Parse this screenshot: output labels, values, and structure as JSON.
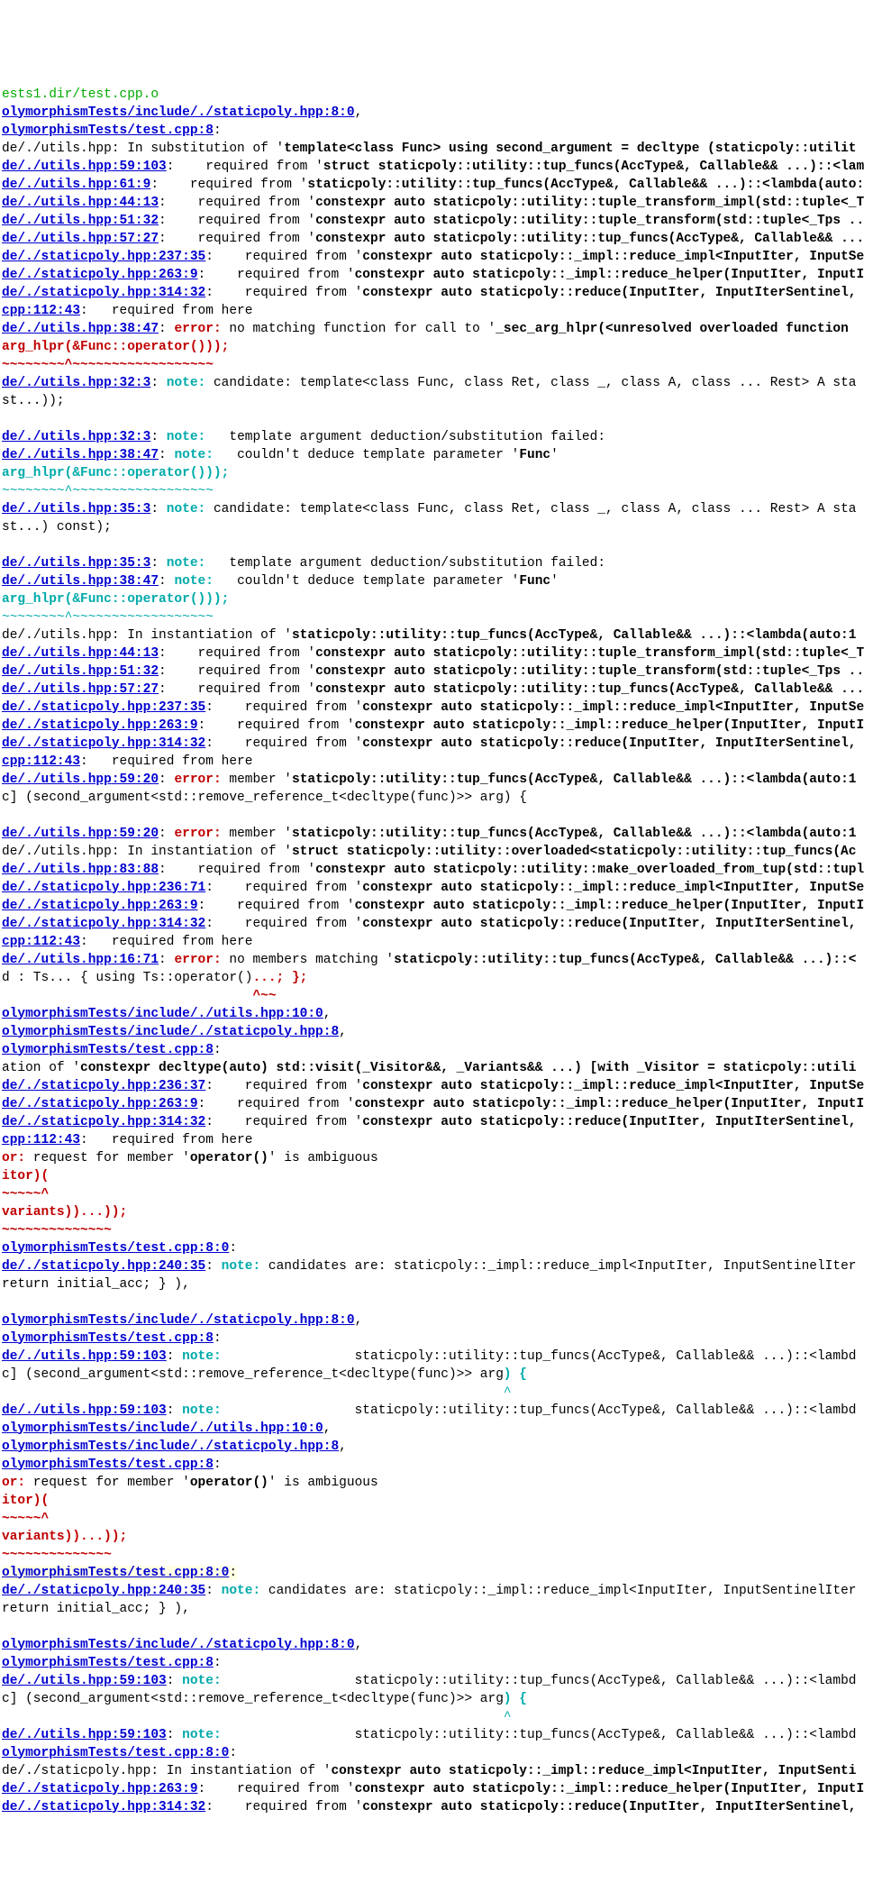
{
  "p": {
    "utils": "de/./utils.hpp",
    "sp": "de/./staticpoly.hpp",
    "inc_sp": "olymorphismTests/include/./staticpoly.hpp:8:0",
    "inc_sp8": "olymorphismTests/include/./staticpoly.hpp:8",
    "inc_ut": "olymorphismTests/include/./utils.hpp:10:0",
    "test80": "olymorphismTests/test.cpp:8:0",
    "test8": "olymorphismTests/test.cpp:8",
    "cpp112": "cpp:112:43"
  },
  "loc": {
    "u59_103": ":59:103",
    "u61_9": ":61:9",
    "u44_13": ":44:13",
    "u51_32": ":51:32",
    "u57_27": ":57:27",
    "u38_47": ":38:47",
    "u32_3": ":32:3",
    "u35_3": ":35:3",
    "u59_20": ":59:20",
    "u83_88": ":83:88",
    "u16_71": ":16:71",
    "s237_35": ":237:35",
    "s263_9": ":263:9",
    "s314_32": ":314:32",
    "s236_71": ":236:71",
    "s236_37": ":236:37",
    "s240_35": ":240:35"
  },
  "txt": {
    "obj": "ests1.dir/test.cpp.o",
    "comma": ",",
    "colon": ":",
    "reqfrom": ":   required from '",
    "reqfrom2": ":    required from '",
    "reqfrom3": ":     required from '",
    "reqhere": ":   required from here",
    "error": " error:",
    "note": " note:",
    "or_amb": " request for member '",
    "or_pre": "or:",
    "op": "operator()",
    "amb_tail": "' is ambiguous",
    "itor": "itor)(",
    "itor_tilde": "~~~~~^",
    "variants": "variants))...)",
    "variants_tilde": "~~~~~~~~~~~~~~",
    "semicolon": ");",
    "subst": "de/./utils.hpp: In substitution of '",
    "subst_arg": "template<class Func> using second_argument = decltype (staticpoly::utilit",
    "struct_tup": "struct staticpoly::utility::tup_funcs(AccType&, Callable&& ...)::<lam",
    "lambda_auto1": "staticpoly::utility::tup_funcs(AccType&, Callable&& ...)::<lambda(auto:1",
    "lambda_auto_": "staticpoly::utility::tup_funcs(AccType&, Callable&& ...)::<lambda(auto:",
    "tuple_impl": "constexpr auto staticpoly::utility::tuple_transform_impl(std::tuple<_T",
    "tuple_trans": "constexpr auto staticpoly::utility::tuple_transform(std::tuple<_Tps ..",
    "tup_funcs": "constexpr auto staticpoly::utility::tup_funcs(AccType&, Callable&& ...",
    "reduce_impl": "constexpr auto staticpoly::_impl::reduce_impl<InputIter, InputSe",
    "reduce_helper": "constexpr auto staticpoly::_impl::reduce_helper(InputIter, InputI",
    "reduce": "constexpr auto staticpoly::reduce(InputIter, InputIterSentinel, ",
    "nomatch": " no matching function for call to '",
    "sec_arg": "_sec_arg_hlpr(<unresolved overloaded function ",
    "arg_hlpr": "arg_hlpr(&Func::operator())",
    "arg_tilde": "~~~~~~~~^~~~~~~~~~~~~~~~~~~",
    "cand": " candidate: template<class Func, class Ret, class _, class A, class ... Rest> A sta",
    "st_tail": "st...));",
    "st_tail_c": "st...) const);",
    "ded_fail": "   template argument deduction/substitution failed:",
    "couldnt": "   couldn't deduce template parameter '",
    "Func": "Func",
    "qtail": "'",
    "inst_of": "de/./utils.hpp: In instantiation of '",
    "member": " member '",
    "c_second": "c] (second_argument<std::remove_reference_t<decltype(func)>> arg) {",
    "c_second_p": "c] (second_argument<std::remove_reference_t<decltype(func)>> arg",
    "brace_close": ") {",
    "caret_under": "                                                                ^",
    "overloaded": "struct staticpoly::utility::overloaded<staticpoly::utility::tup_funcs(Ac",
    "make_overload": "constexpr auto staticpoly::utility::make_overloaded_from_tup(std::tupl",
    "nomembers": " no members matching '",
    "tupfuncs_mem": "staticpoly::utility::tup_funcs(AccType&, Callable&& ...)::<",
    "d_ts": "d : Ts... { using Ts::operator()",
    "d_ts_tail": "...; };",
    "d_ts_caret": "                                ^~~",
    "visit": "ation of '",
    "visit_bold": "constexpr decltype(auto) std::visit(_Visitor&&, _Variants&& ...) [with _Visitor = staticpoly::utili",
    "candidates": " candidates are: staticpoly::_impl::reduce_impl<InputIter, InputSentinelIter",
    "ret_acc": "return initial_acc; } ),",
    "note_pad": "                 staticpoly::utility::tup_funcs(AccType&, Callable&& ...)::<lambd",
    "sp_inst": "de/./staticpoly.hpp: In instantiation of '",
    "sp_inst_arg": "constexpr auto staticpoly::_impl::reduce_impl<InputIter, InputSenti"
  }
}
